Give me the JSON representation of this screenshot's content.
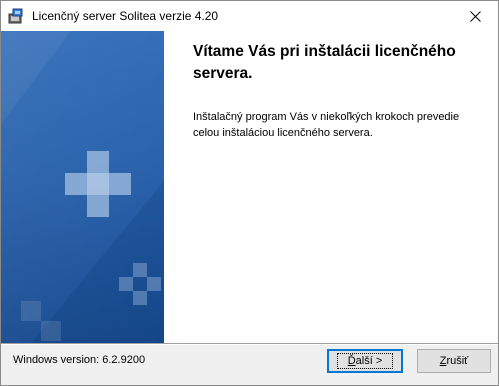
{
  "window": {
    "title": "Licenčný server Solitea verzie 4.20",
    "close_icon": "close-icon",
    "app_icon": "installer-app-icon"
  },
  "side_panel": {
    "decoration": "blue-cross-decoration-image",
    "colors": [
      "#2c69b6",
      "#174a8f"
    ]
  },
  "main": {
    "title": "Vítame Vás pri inštalácii licenčného servera.",
    "description": "Inštalačný program Vás v niekoľkých krokoch prevedie celou inštaláciou licenčného servera."
  },
  "footer": {
    "windows_version": "Windows version: 6.2.9200",
    "next_button": {
      "label_mnemonic": "Ď",
      "label_rest": "alší >"
    },
    "cancel_button": {
      "label_mnemonic": "Z",
      "label_rest": "rušiť"
    }
  }
}
